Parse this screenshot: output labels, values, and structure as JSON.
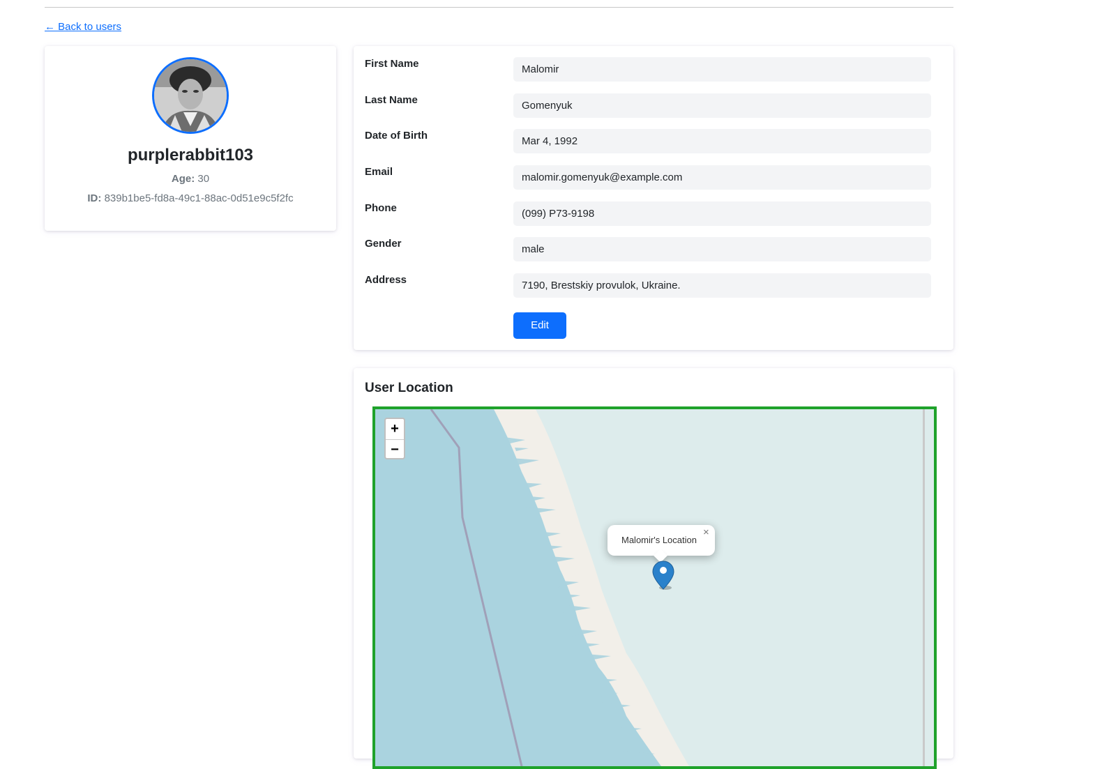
{
  "nav": {
    "back_label": "← Back to users"
  },
  "profile": {
    "username": "purplerabbit103",
    "age_label": "Age:",
    "age_value": "30",
    "id_label": "ID:",
    "id_value": "839b1be5-fd8a-49c1-88ac-0d51e9c5f2fc"
  },
  "details": {
    "fields": [
      {
        "label": "First Name",
        "value": "Malomir"
      },
      {
        "label": "Last Name",
        "value": "Gomenyuk"
      },
      {
        "label": "Date of Birth",
        "value": "Mar 4, 1992"
      },
      {
        "label": "Email",
        "value": "malomir.gomenyuk@example.com"
      },
      {
        "label": "Phone",
        "value": "(099) P73-9198"
      },
      {
        "label": "Gender",
        "value": "male"
      },
      {
        "label": "Address",
        "value": "7190, Brestskiy provulok, Ukraine."
      }
    ],
    "edit_label": "Edit"
  },
  "map": {
    "title": "User Location",
    "zoom_in": "+",
    "zoom_out": "−",
    "popup_text": "Malomir's Location",
    "popup_close": "×",
    "marker_icon": "map-pin-icon",
    "colors": {
      "frame": "#1fa22b",
      "water": "#aad3df",
      "land": "#f2efe9",
      "ice": "#ddecec",
      "marker": "#2a81cb",
      "accent": "#0d6efd"
    }
  }
}
